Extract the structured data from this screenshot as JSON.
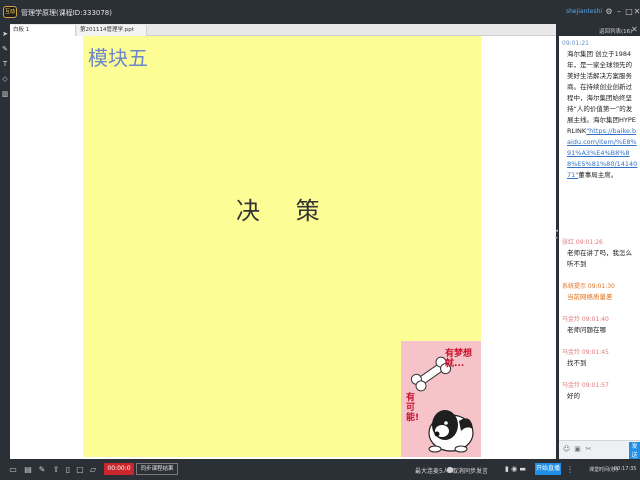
{
  "window": {
    "logo_text": "互动",
    "title": "管理学原理(课程ID:333078)",
    "username": "shejianteshi"
  },
  "icons": {
    "settings": "gear-icon",
    "minimize": "minimize-icon",
    "maximize": "maximize-icon",
    "close": "close-icon"
  },
  "tabs": [
    {
      "label": "白板 1"
    },
    {
      "label": "第201114管理学.ppt"
    }
  ],
  "slide": {
    "module_title": "模块五",
    "heading": "决  策",
    "sticker": {
      "top_text": "有梦想就...",
      "bottom_text": "有可能!"
    }
  },
  "chat": {
    "return_list_label": "返回列表(16)",
    "messages": [
      {
        "time": "09:01:21",
        "text": "海尔集团 创立于1984年，是一家全球领先的美好生活解决方案服务商。在持续创业创新过程中，海尔集团始终坚持“人的价值第一”的发展主线。海尔集团HYPERLINK",
        "link": "\"https://baike.baidu.com/item/%E8%91%A3%E4%B8%88%E5%81%80/1414071\"",
        "suffix": "董事局主席。",
        "type": "normal"
      },
      {
        "time": "张红 09:01:26",
        "text": "老师在讲了吗，我怎么听不到",
        "type": "normal"
      },
      {
        "time": "系统提示 09:01:30",
        "text": "当前网络质量差",
        "type": "system"
      },
      {
        "time": "马金玲 09:01:40",
        "text": "老师问题在哪",
        "type": "normal"
      },
      {
        "time": "马金玲 09:01:45",
        "text": "找不到",
        "type": "normal"
      },
      {
        "time": "马金玲 09:01:57",
        "text": "好的",
        "type": "normal"
      }
    ],
    "send_label": "发送"
  },
  "bottom": {
    "record_time": "00:00:0",
    "start_class_label": "同步课程结果",
    "mic_label": "最大连麦5人",
    "speaker_label": "取消同步发言",
    "video_button": "开始直播",
    "status": "课堂时间(秒)",
    "time": "00:17:35"
  }
}
